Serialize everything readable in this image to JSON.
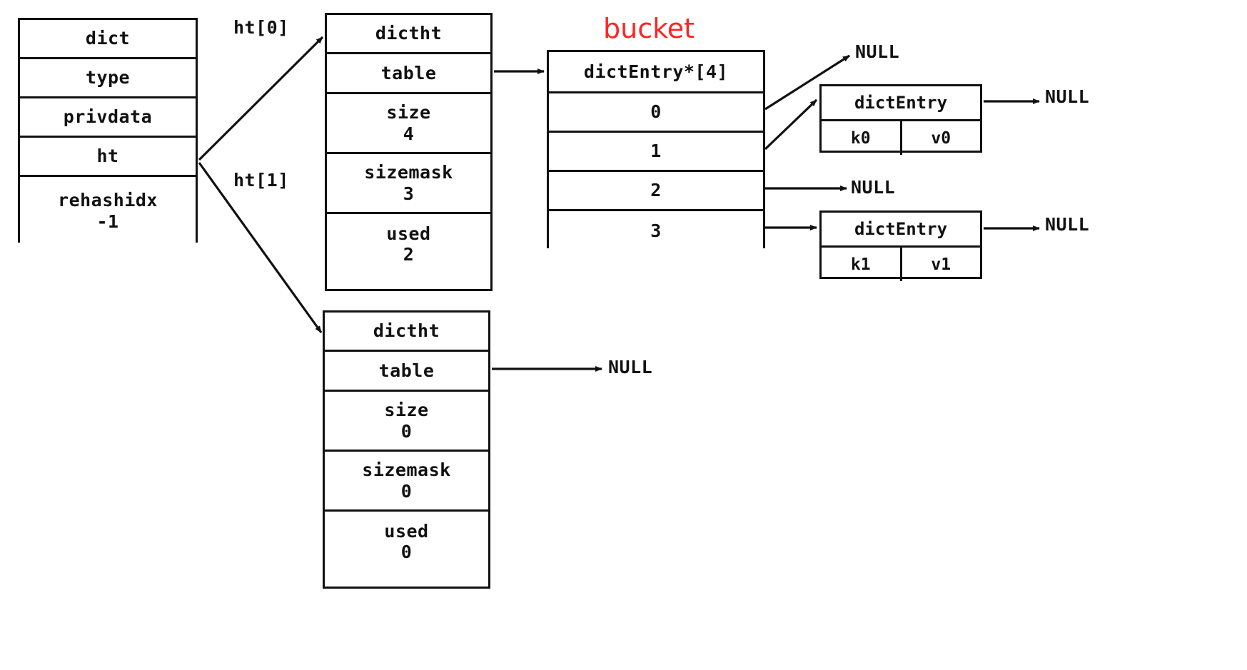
{
  "diagram": {
    "title_label": "bucket",
    "accent_color": "#ff2424",
    "line_color": "#111111",
    "background": "#ffffff"
  },
  "dict_struct": {
    "name": "dict",
    "fields": [
      {
        "name": "type",
        "value": ""
      },
      {
        "name": "privdata",
        "value": ""
      },
      {
        "name": "ht",
        "value": ""
      },
      {
        "name": "rehashidx",
        "value": "-1"
      }
    ]
  },
  "pointer_labels": {
    "ht0": "ht[0]",
    "ht1": "ht[1]"
  },
  "hashtables": [
    {
      "id": "ht0",
      "name": "dictht",
      "fields": [
        {
          "name": "table",
          "value": ""
        },
        {
          "name": "size",
          "value": "4"
        },
        {
          "name": "sizemask",
          "value": "3"
        },
        {
          "name": "used",
          "value": "2"
        }
      ]
    },
    {
      "id": "ht1",
      "name": "dictht",
      "fields": [
        {
          "name": "table",
          "value": ""
        },
        {
          "name": "size",
          "value": "0"
        },
        {
          "name": "sizemask",
          "value": "0"
        },
        {
          "name": "used",
          "value": "0"
        }
      ],
      "table_target": "NULL"
    }
  ],
  "bucket_array": {
    "header": "dictEntry*[4]",
    "indices": [
      "0",
      "1",
      "2",
      "3"
    ],
    "targets": [
      "NULL",
      "dictEntry(k0,v0)",
      "NULL",
      "dictEntry(k1,v1)"
    ]
  },
  "entries": [
    {
      "id": "entry0",
      "name": "dictEntry",
      "key": "k0",
      "value": "v0",
      "next": "NULL"
    },
    {
      "id": "entry1",
      "name": "dictEntry",
      "key": "k1",
      "value": "v1",
      "next": "NULL"
    }
  ],
  "null_labels": {
    "bucket0": "NULL",
    "bucket2": "NULL",
    "entry0_next": "NULL",
    "entry1_next": "NULL",
    "ht1_table": "NULL"
  }
}
